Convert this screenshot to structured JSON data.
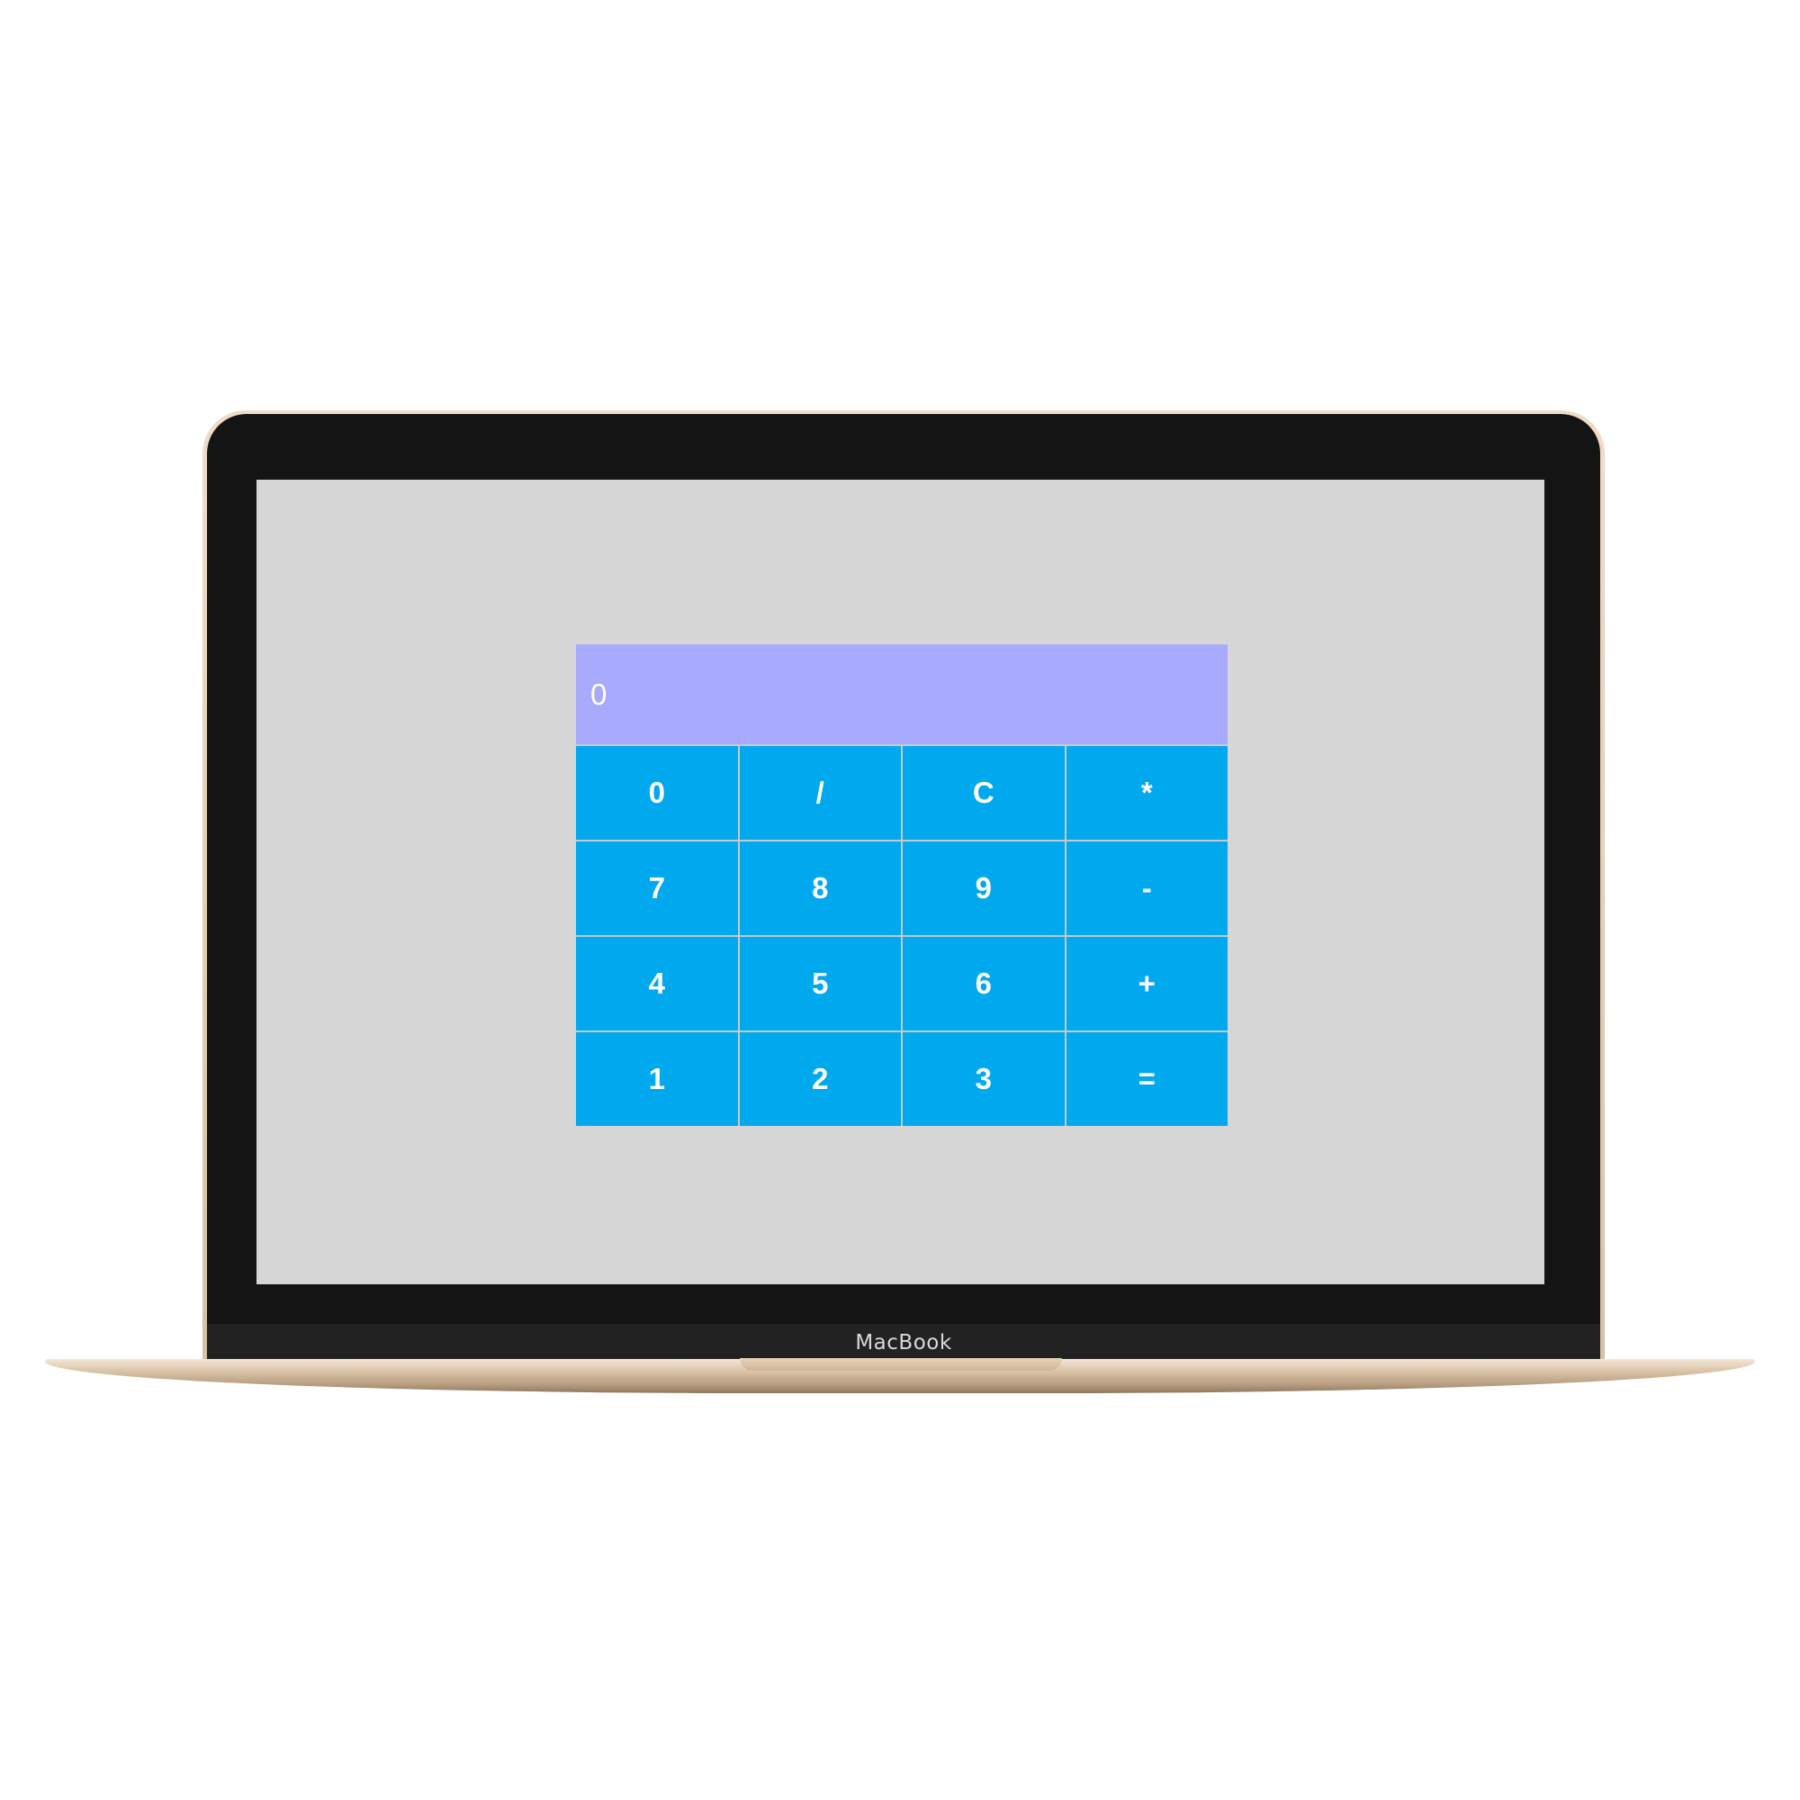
{
  "device": {
    "brand_label": "MacBook"
  },
  "calculator": {
    "display_value": "0",
    "keys": [
      "0",
      "/",
      "C",
      "*",
      "7",
      "8",
      "9",
      "-",
      "4",
      "5",
      "6",
      "+",
      "1",
      "2",
      "3",
      "="
    ]
  },
  "colors": {
    "screen_background": "#d6d6d6",
    "display_background": "#a8aafd",
    "key_background": "#00a8ee",
    "key_text": "#ffffff"
  }
}
